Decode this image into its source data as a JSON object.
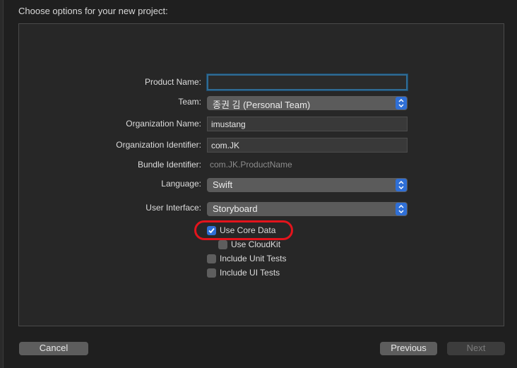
{
  "sheet": {
    "title": "Choose options for your new project:"
  },
  "form": {
    "product_name": {
      "label": "Product Name:",
      "value": ""
    },
    "team": {
      "label": "Team:",
      "value": "종권 김 (Personal Team)"
    },
    "organization_name": {
      "label": "Organization Name:",
      "value": "imustang"
    },
    "organization_identifier": {
      "label": "Organization Identifier:",
      "value": "com.JK"
    },
    "bundle_identifier": {
      "label": "Bundle Identifier:",
      "value": "com.JK.ProductName"
    },
    "language": {
      "label": "Language:",
      "value": "Swift"
    },
    "user_interface": {
      "label": "User Interface:",
      "value": "Storyboard"
    }
  },
  "options": {
    "use_core_data": {
      "label": "Use Core Data",
      "checked": true
    },
    "use_cloudkit": {
      "label": "Use CloudKit",
      "checked": false
    },
    "include_unit_tests": {
      "label": "Include Unit Tests",
      "checked": false
    },
    "include_ui_tests": {
      "label": "Include UI Tests",
      "checked": false
    }
  },
  "footer": {
    "cancel_label": "Cancel",
    "previous_label": "Previous",
    "next_label": "Next"
  },
  "colors": {
    "accent": "#2f6fd6",
    "highlight_ring": "#e3141c",
    "focus_ring": "#2f6b94"
  }
}
